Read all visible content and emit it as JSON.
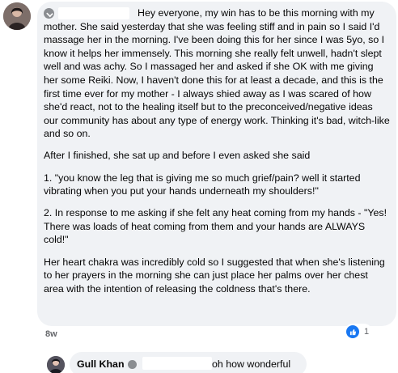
{
  "post": {
    "paragraphs": [
      "Hey everyone, my win has to be this morning with my mother. She said yesterday that she was feeling stiff and in pain so I said I'd massage her in the morning. I've been doing this for her since I was 5yo, so I know it helps her immensely. This morning she really felt unwell, hadn't slept well and was achy. So I massaged her and asked if she OK with me giving her some Reiki. Now, I haven't done this for at least a decade, and this is the first time ever for my mother - I always shied away as I was scared of how she'd react, not to the healing itself but to the preconceived/negative ideas our community has about any type of energy work. Thinking it's bad, witch-like and so on.",
      "After I finished, she sat up and before I even asked she said",
      "1. \"you know the leg that is giving me so much grief/pain? well it started vibrating when you put your hands underneath my shoulders!\"",
      "2. In response to me asking if she felt any heat coming from my hands - \"Yes! There was loads of heat coming from them and your hands are ALWAYS cold!\"",
      "Her heart chakra was incredibly cold so I suggested that when she's listening to her prayers in the morning she can just place her palms over her chest area with the intention of releasing the coldness that's there."
    ],
    "timestamp": "8w",
    "reaction_icon": "like-icon",
    "reaction_count": "1"
  },
  "reply": {
    "author": "Gull Khan",
    "text": "oh how wonderful"
  },
  "colors": {
    "bubble": "#f0f2f5",
    "like": "#1877f2",
    "meta": "#65676b"
  }
}
